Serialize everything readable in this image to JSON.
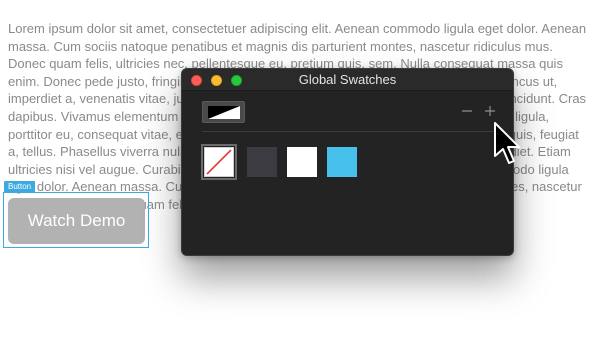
{
  "page": {
    "lorem_text": "Lorem ipsum dolor sit amet, consectetuer adipiscing elit. Aenean commodo ligula eget dolor. Aenean massa. Cum sociis natoque penatibus et magnis dis parturient montes, nascetur ridiculus mus. Donec quam felis, ultricies nec, pellentesque eu, pretium quis, sem. Nulla consequat massa quis enim. Donec pede justo, fringilla vel, aliquet nec, vulputate eget, arcu. In enim justo, rhoncus ut, imperdiet a, venenatis vitae, justo. Nullam dictum felis eu pede mollis pretium. Integer tincidunt. Cras dapibus. Vivamus elementum semper nisi. Aenean vulputate eleifend tellus. Aenean leo ligula, porttitor eu, consequat vitae, eleifend ac, enim. Aliquam lorem ante, dapibus in, viverra quis, feugiat a, tellus. Phasellus viverra nulla ut metus varius laoreet. Quisque rutrum. Aenean imperdiet. Etiam ultricies nisi vel augue. Curabitur ullamcorper ultricies nisi. Nam eget dui. Aenean commodo ligula eget dolor. Aenean massa. Cum sociis natoque penatibus et magnis dis parturient montes, nascetur ridiculus mus. Donec quam felis, ultricies nec, pellentesque eu, pretium quis, sem.",
    "button_tag": "Button",
    "watch_demo_label": "Watch Demo"
  },
  "swatch_panel": {
    "title": "Global Swatches",
    "fill_stroke_icon": "fill-stroke-toggle-icon",
    "remove_icon": "minus-icon",
    "add_icon": "plus-icon",
    "swatches": [
      {
        "name": "none",
        "color": "#ffffff",
        "icon": "no-color-slash-icon"
      },
      {
        "name": "dark-gray",
        "color": "#3d3b42"
      },
      {
        "name": "white",
        "color": "#ffffff"
      },
      {
        "name": "light-blue",
        "color": "#48c0ec"
      }
    ]
  },
  "colors": {
    "panel_bg": "#232323",
    "button_bg": "#b2b2b2",
    "selection_blue": "#3ea8e1",
    "text_gray": "#8a8a8a"
  },
  "cursor": {
    "icon": "arrow-cursor-icon"
  }
}
